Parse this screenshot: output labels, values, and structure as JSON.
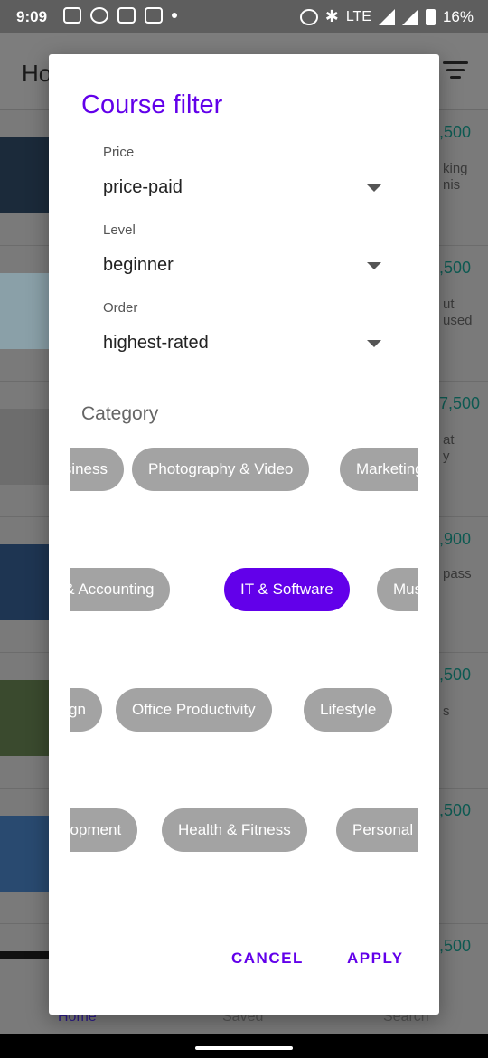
{
  "status_bar": {
    "time": "9:09",
    "network": "LTE",
    "battery": "16%",
    "icons": [
      "message-icon",
      "whatsapp-icon",
      "gmail-icon",
      "vibrate-icon",
      "dot-icon",
      "alarm-icon",
      "bluetooth-icon",
      "signal-icon",
      "battery-icon"
    ]
  },
  "background_app": {
    "header_title": "Ho",
    "prices": [
      ",500",
      ",500",
      "7,500",
      ",900",
      ",500",
      ",500",
      ",500"
    ],
    "snippets": [
      [
        "king",
        "nis"
      ],
      [
        "ut",
        "used"
      ],
      [
        "at",
        "y"
      ],
      [
        "pass"
      ],
      [
        "s"
      ]
    ],
    "nav": {
      "home": "Home",
      "saved": "Saved",
      "search": "Search"
    }
  },
  "dialog": {
    "title": "Course filter",
    "fields": [
      {
        "label": "Price",
        "value": "price-paid"
      },
      {
        "label": "Level",
        "value": "beginner"
      },
      {
        "label": "Order",
        "value": "highest-rated"
      }
    ],
    "category_label": "Category",
    "chip_rows": [
      [
        "Business",
        "Photography & Video",
        "Marketing"
      ],
      [
        "Finance & Accounting",
        "IT & Software",
        "Music"
      ],
      [
        "Design",
        "Office Productivity",
        "Lifestyle"
      ],
      [
        "Development",
        "Health & Fitness",
        "Personal Development"
      ]
    ],
    "selected_category": "IT & Software",
    "cancel_label": "CANCEL",
    "apply_label": "APPLY"
  },
  "colors": {
    "accent": "#6200ea",
    "chip": "#a3a3a3",
    "scrim": "#7a7a7a"
  }
}
